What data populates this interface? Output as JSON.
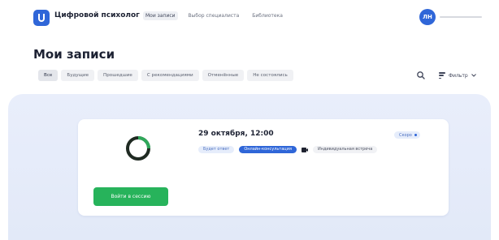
{
  "header": {
    "brand": "Цифровой психолог",
    "nav": [
      "Мои записи",
      "Выбор специалиста",
      "Библиотека"
    ],
    "user_initials": "ЛН"
  },
  "page": {
    "title": "Мои записи",
    "tabs": [
      "Все",
      "Будущие",
      "Прошедшие",
      "С рекомендациями",
      "Отменённые",
      "Не состоялись"
    ],
    "filter_label": "Фильтр"
  },
  "appointment": {
    "date": "29 октября, 12:00",
    "status": "Скоро",
    "tags": [
      "Будет ответ",
      "Онлайн-консультация",
      "Индивидуальная встреча"
    ],
    "join_label": "Войти в сессию"
  },
  "colors": {
    "accent": "#2f66d8",
    "success": "#27b35b",
    "background_panel": "#e6ecfa"
  }
}
